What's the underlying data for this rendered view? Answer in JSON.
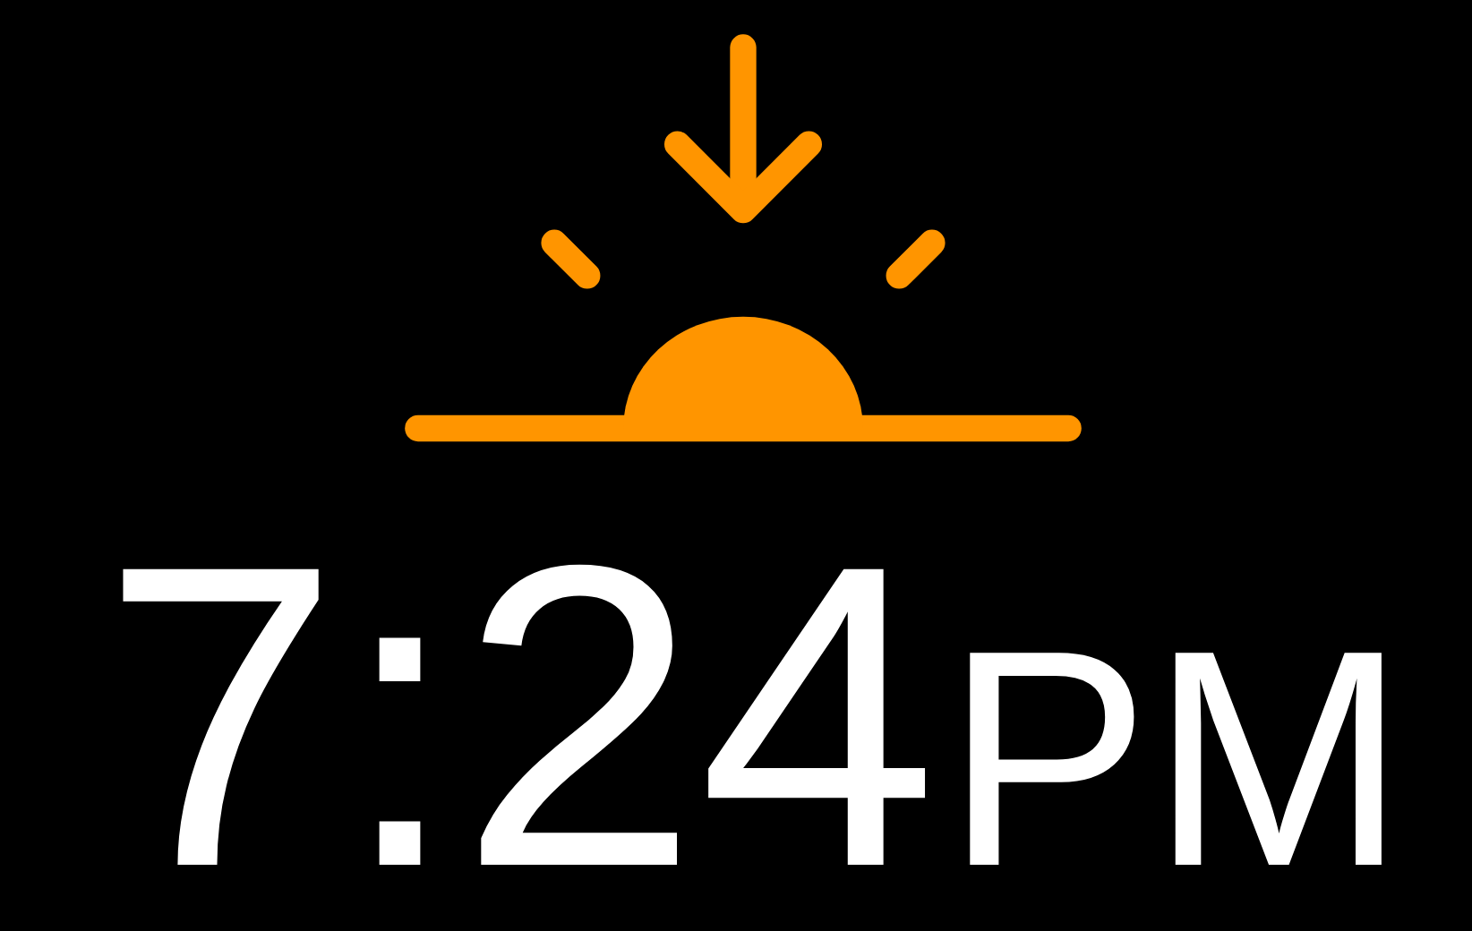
{
  "complication": {
    "time": "7:24",
    "period": "PM"
  }
}
